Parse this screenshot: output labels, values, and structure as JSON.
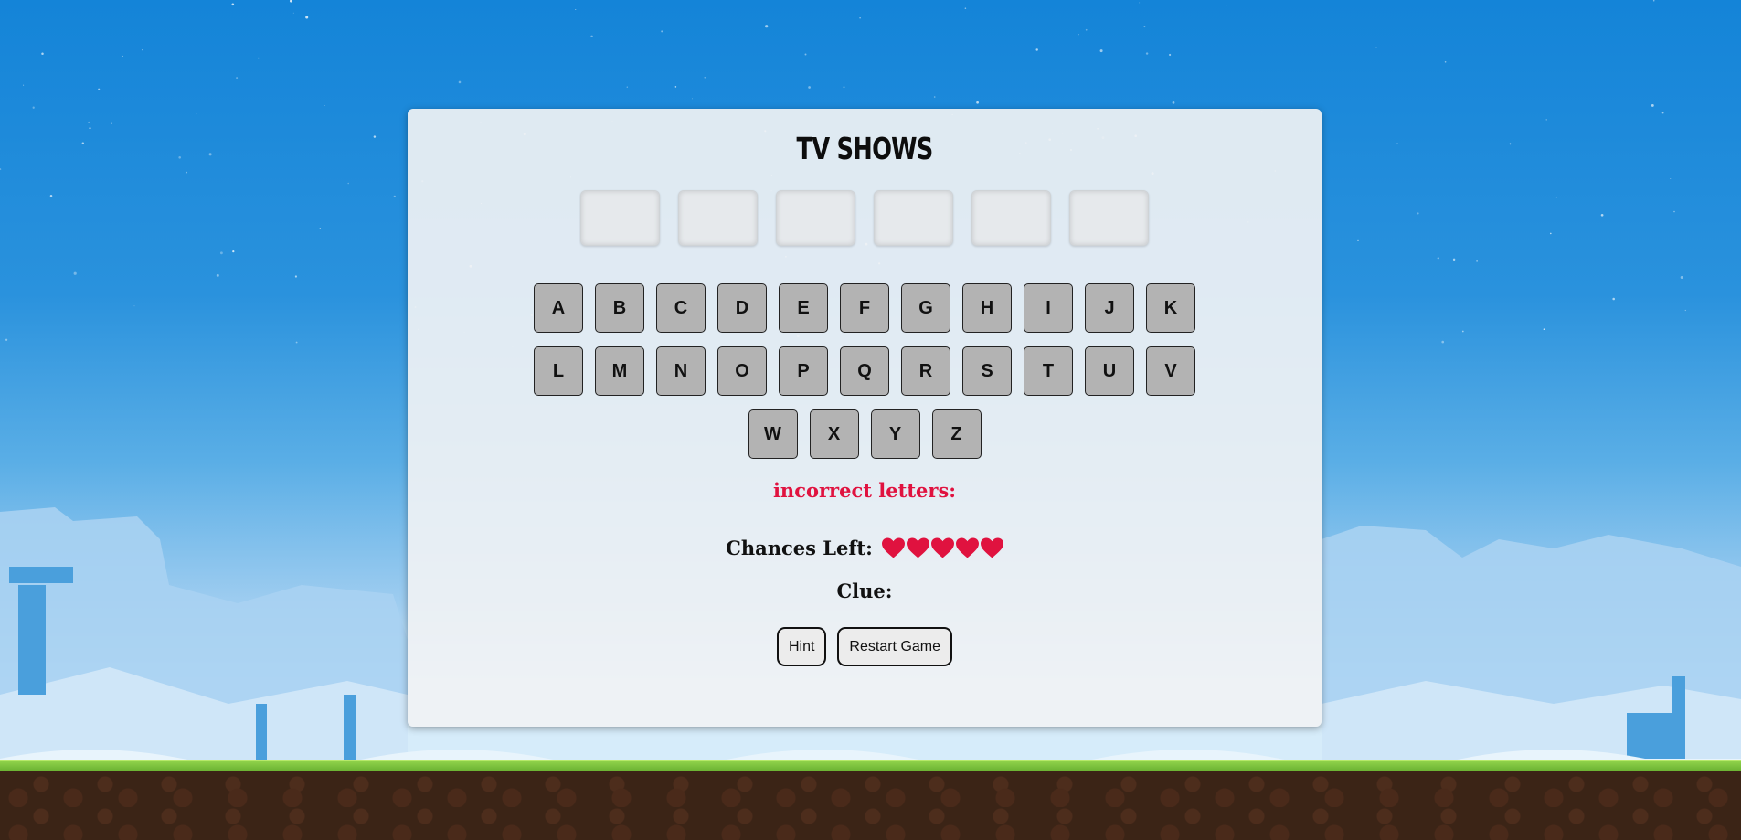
{
  "game": {
    "title": "TV SHOWS",
    "slot_count": 6,
    "keyboard_rows": [
      [
        "A",
        "B",
        "C",
        "D",
        "E",
        "F",
        "G",
        "H",
        "I",
        "J",
        "K"
      ],
      [
        "L",
        "M",
        "N",
        "O",
        "P",
        "Q",
        "R",
        "S",
        "T",
        "U",
        "V"
      ],
      [
        "W",
        "X",
        "Y",
        "Z"
      ]
    ],
    "incorrect_label": "incorrect letters:",
    "chances_label": "Chances Left:",
    "chances_remaining": 5,
    "clue_label": "Clue:",
    "hint_button": "Hint",
    "restart_button": "Restart Game"
  },
  "colors": {
    "heart": "#e0123f",
    "incorrect_text": "#e0123f",
    "key_bg": "#b3b3b3"
  }
}
